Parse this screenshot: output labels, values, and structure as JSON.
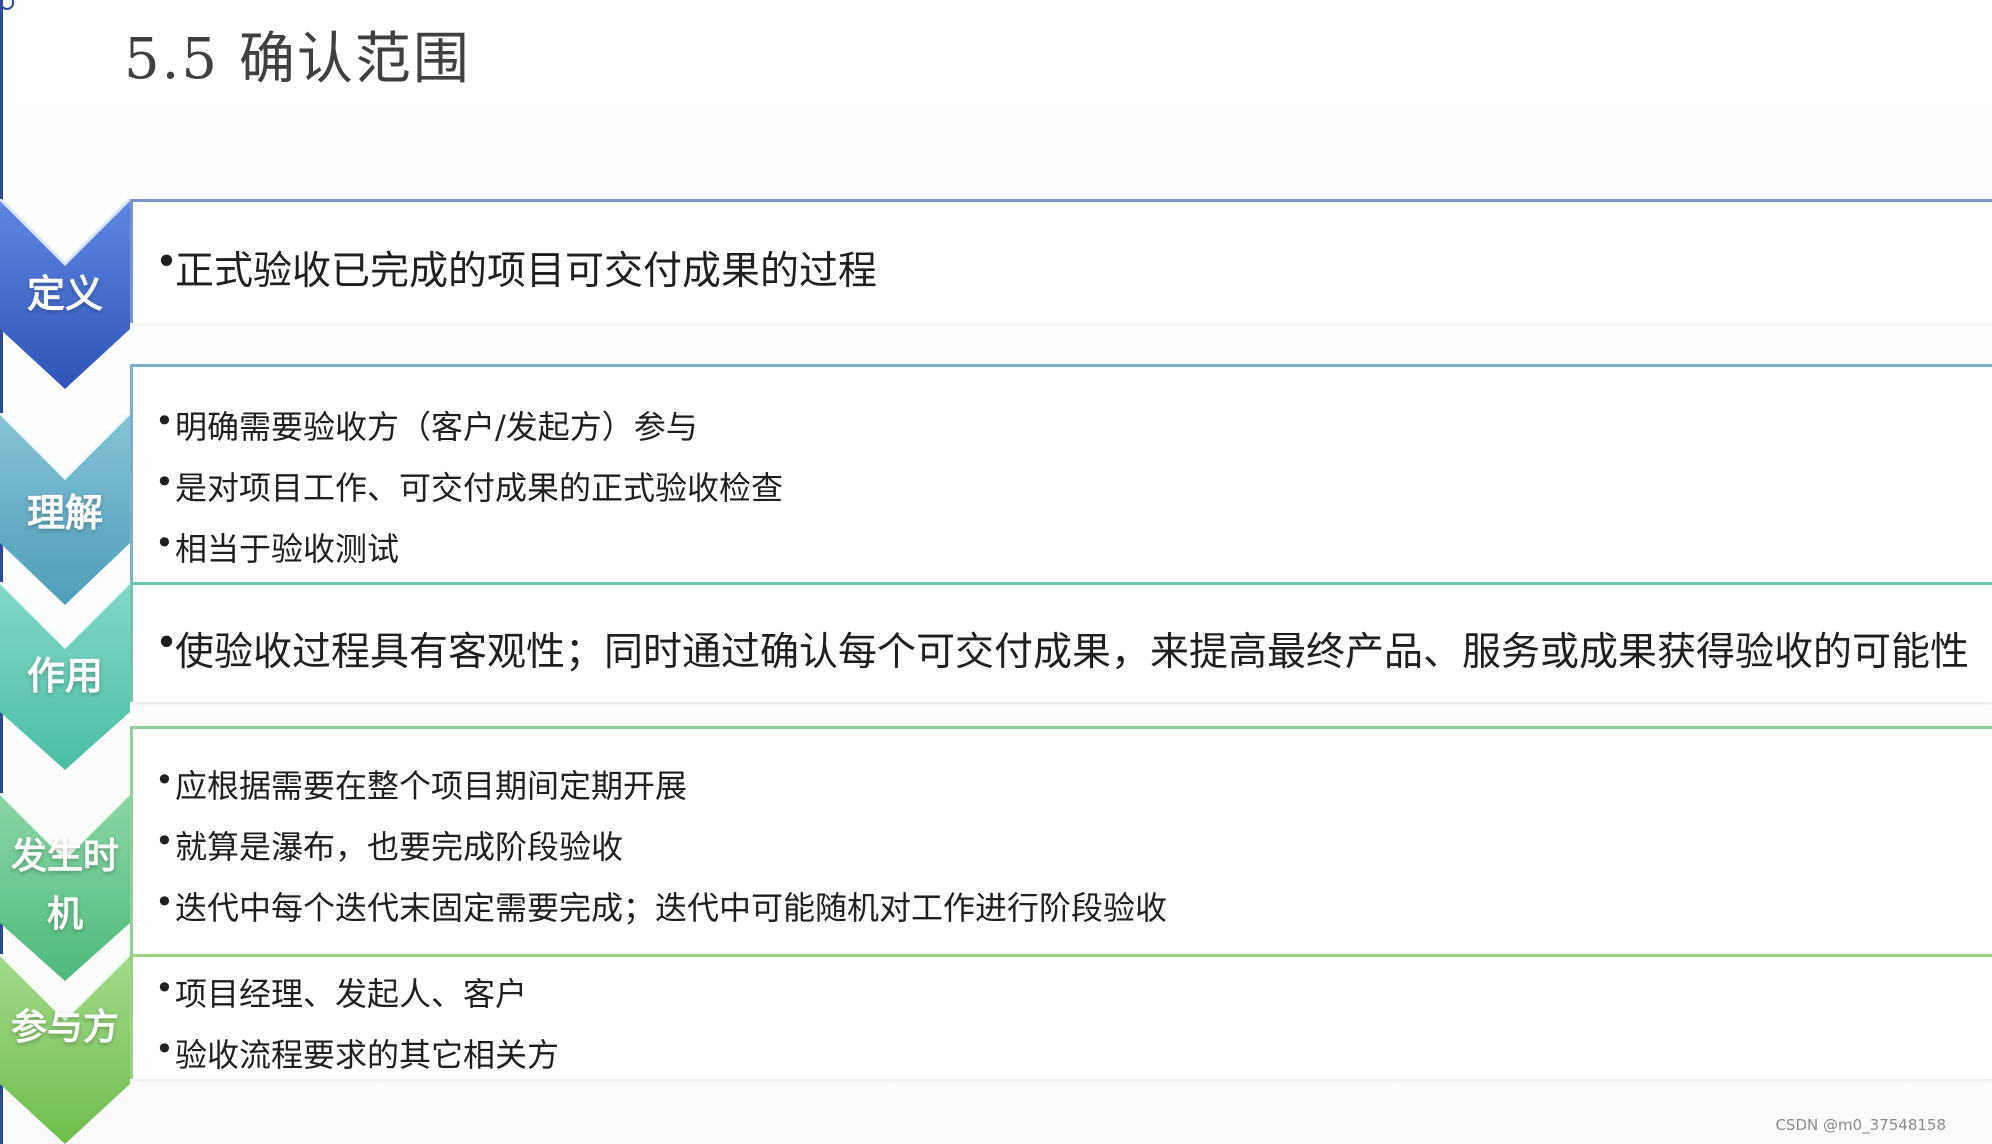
{
  "slide": {
    "title": "5.5  确认范围",
    "sections": [
      {
        "label": "定义",
        "items": [
          "正式验收已完成的项目可交付成果的过程"
        ],
        "color": "#3f67c9"
      },
      {
        "label": "理解",
        "items": [
          "明确需要验收方（客户/发起方）参与",
          "是对项目工作、可交付成果的正式验收检查",
          "相当于验收测试"
        ],
        "color": "#5aa7c4"
      },
      {
        "label": "作用",
        "items": [
          "使验收过程具有客观性；同时通过确认每个可交付成果，来提高最终产品、服务或成果获得验收的可能性"
        ],
        "color": "#58c3ae"
      },
      {
        "label": "发生时机",
        "label_lines": [
          "发生时",
          "机"
        ],
        "items": [
          "应根据需要在整个项目期间定期开展",
          "就算是瀑布，也要完成阶段验收",
          "迭代中每个迭代末固定需要完成；迭代中可能随机对工作进行阶段验收"
        ],
        "color": "#60c58f"
      },
      {
        "label": "参与方",
        "items": [
          "项目经理、发起人、客户",
          "验收流程要求的其它相关方"
        ],
        "color": "#7fcb62"
      }
    ]
  },
  "footer": {
    "watermark": "CSDN @m0_37548158"
  },
  "colors": {
    "title": "#404040",
    "text": "#1f1f1f",
    "left_rule": "#2d4a9a"
  }
}
